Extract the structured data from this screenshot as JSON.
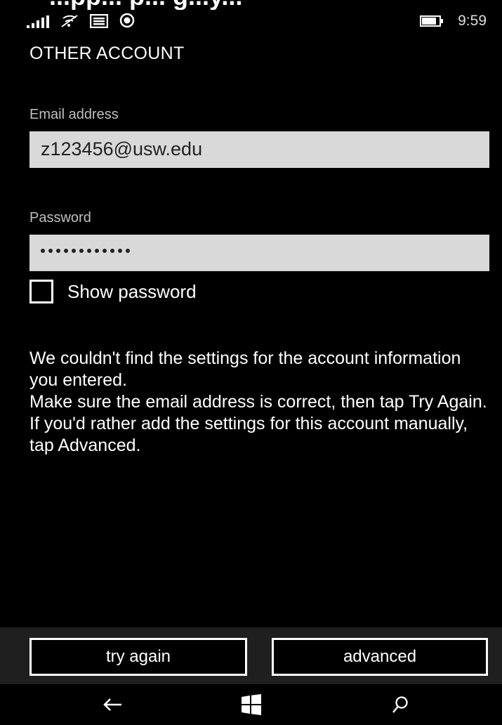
{
  "overlay_text": "...pp... p... g...y...",
  "status_bar": {
    "time": "9:59",
    "icons": [
      "signal-icon",
      "wifi-icon",
      "message-icon",
      "location-icon",
      "battery-icon"
    ]
  },
  "page": {
    "title": "OTHER ACCOUNT"
  },
  "email": {
    "label": "Email address",
    "value": "z123456@usw.edu"
  },
  "password": {
    "label": "Password",
    "masked_length": 12
  },
  "show_password": {
    "label": "Show password",
    "checked": false
  },
  "message": {
    "line1": "We couldn't find the settings for the account information you entered.",
    "line2": "Make sure the email address is correct, then tap Try Again. If you'd rather add the settings for this account manually, tap Advanced."
  },
  "app_bar": {
    "try_again_label": "try again",
    "advanced_label": "advanced"
  },
  "nav_bar": {
    "icons": [
      "back-arrow-icon",
      "windows-start-icon",
      "search-icon"
    ]
  }
}
